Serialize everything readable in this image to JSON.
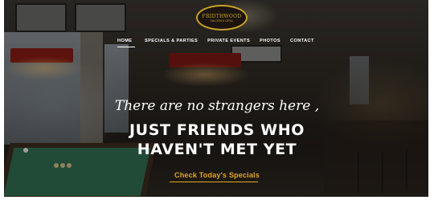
{
  "brand": {
    "logo_text": "FRIDTHWOOD",
    "logo_sub": "SALOON & GRILL"
  },
  "nav": {
    "items": [
      {
        "label": "HOME"
      },
      {
        "label": "SPECIALS & PARTIES"
      },
      {
        "label": "PRIVATE EVENTS"
      },
      {
        "label": "PHOTOS"
      },
      {
        "label": "CONTACT"
      }
    ]
  },
  "hero": {
    "tagline": "There are no strangers here ,",
    "headline_line1": "JUST FRIENDS WHO",
    "headline_line2": "HAVEN'T MET YET",
    "cta": "Check Today's Specials"
  },
  "colors": {
    "accent": "#e0a62a",
    "logo_gold": "#c9a227"
  }
}
